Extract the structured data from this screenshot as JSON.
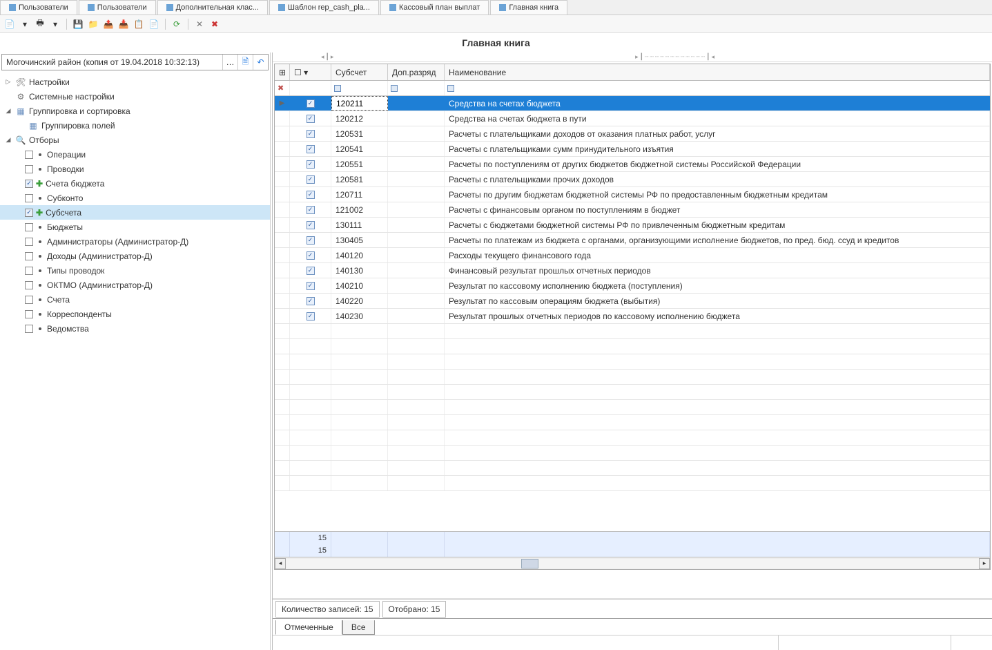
{
  "tabs": [
    {
      "label": "Пользователи"
    },
    {
      "label": "Пользователи"
    },
    {
      "label": "Дополнительная клас..."
    },
    {
      "label": "Шаблон rep_cash_pla..."
    },
    {
      "label": "Кассовый план выплат"
    },
    {
      "label": "Главная книга"
    }
  ],
  "main_title": "Главная книга",
  "left_header": {
    "text": "Могочинский район (копия от 19.04.2018 10:32:13)"
  },
  "tree": [
    {
      "depth": 0,
      "exp": "▷",
      "icon": "wrench",
      "label": "Настройки"
    },
    {
      "depth": 0,
      "exp": "",
      "icon": "gear",
      "label": "Системные настройки"
    },
    {
      "depth": 0,
      "exp": "◢",
      "icon": "grid",
      "label": "Группировка и сортировка"
    },
    {
      "depth": 1,
      "exp": "",
      "icon": "grid",
      "label": "Группировка полей"
    },
    {
      "depth": 0,
      "exp": "◢",
      "icon": "filter",
      "label": "Отборы"
    },
    {
      "depth": 1,
      "chk": false,
      "dot": true,
      "label": "Операции"
    },
    {
      "depth": 1,
      "chk": false,
      "dot": true,
      "label": "Проводки"
    },
    {
      "depth": 1,
      "chk": true,
      "plus": true,
      "label": "Счета бюджета"
    },
    {
      "depth": 1,
      "chk": false,
      "dot": true,
      "label": "Субконто"
    },
    {
      "depth": 1,
      "chk": true,
      "plus": true,
      "label": "Субсчета",
      "selected": true
    },
    {
      "depth": 1,
      "chk": false,
      "dot": true,
      "label": "Бюджеты"
    },
    {
      "depth": 1,
      "chk": false,
      "dot": true,
      "label": "Администраторы (Администратор-Д)"
    },
    {
      "depth": 1,
      "chk": false,
      "dot": true,
      "label": "Доходы (Администратор-Д)"
    },
    {
      "depth": 1,
      "chk": false,
      "dot": true,
      "label": "Типы проводок"
    },
    {
      "depth": 1,
      "chk": false,
      "dot": true,
      "label": "ОКТМО (Администратор-Д)"
    },
    {
      "depth": 1,
      "chk": false,
      "dot": true,
      "label": "Счета"
    },
    {
      "depth": 1,
      "chk": false,
      "dot": true,
      "label": "Корреспонденты"
    },
    {
      "depth": 1,
      "chk": false,
      "dot": true,
      "label": "Ведомства"
    }
  ],
  "grid": {
    "columns": {
      "check": "",
      "sub": "Субсчет",
      "dop": "Доп.разряд",
      "name": "Наименование"
    },
    "rows": [
      {
        "chk": true,
        "sub": "120211",
        "dop": "",
        "name": "Средства на счетах бюджета",
        "selected": true
      },
      {
        "chk": true,
        "sub": "120212",
        "dop": "",
        "name": "Средства на счетах бюджета в пути"
      },
      {
        "chk": true,
        "sub": "120531",
        "dop": "",
        "name": "Расчеты с плательщиками доходов от оказания платных работ, услуг"
      },
      {
        "chk": true,
        "sub": "120541",
        "dop": "",
        "name": "Расчеты с плательщиками сумм принудительного изъятия"
      },
      {
        "chk": true,
        "sub": "120551",
        "dop": "",
        "name": "Расчеты по поступлениям от  других бюджетов бюджетной системы Российской Федерации"
      },
      {
        "chk": true,
        "sub": "120581",
        "dop": "",
        "name": "Расчеты с плательщиками прочих доходов"
      },
      {
        "chk": true,
        "sub": "120711",
        "dop": "",
        "name": "Расчеты по другим бюджетам бюджетной системы РФ по предоставленным бюджетным кредитам"
      },
      {
        "chk": true,
        "sub": "121002",
        "dop": "",
        "name": "Расчеты с финансовым органом по поступлениям в бюджет"
      },
      {
        "chk": true,
        "sub": "130111",
        "dop": "",
        "name": "Расчеты с бюджетами бюджетной системы РФ по привлеченным бюджетным кредитам"
      },
      {
        "chk": true,
        "sub": "130405",
        "dop": "",
        "name": "Расчеты по платежам из бюджета с органами, организующими исполнение бюджетов, по пред. бюд. ссуд и кредитов"
      },
      {
        "chk": true,
        "sub": "140120",
        "dop": "",
        "name": "Расходы текущего финансового года"
      },
      {
        "chk": true,
        "sub": "140130",
        "dop": "",
        "name": "Финансовый результат прошлых отчетных периодов"
      },
      {
        "chk": true,
        "sub": "140210",
        "dop": "",
        "name": "Результат по кассовому исполнению бюджета (поступления)"
      },
      {
        "chk": true,
        "sub": "140220",
        "dop": "",
        "name": "Результат по кассовым операциям бюджета (выбытия)"
      },
      {
        "chk": true,
        "sub": "140230",
        "dop": "",
        "name": "Результат прошлых отчетных периодов по кассовому исполнению бюджета"
      }
    ],
    "summary": [
      "15",
      "15"
    ]
  },
  "status": {
    "count": "Количество записей: 15",
    "selected": "Отобрано: 15"
  },
  "bottom_tabs": {
    "marked": "Отмеченные",
    "all": "Все"
  }
}
